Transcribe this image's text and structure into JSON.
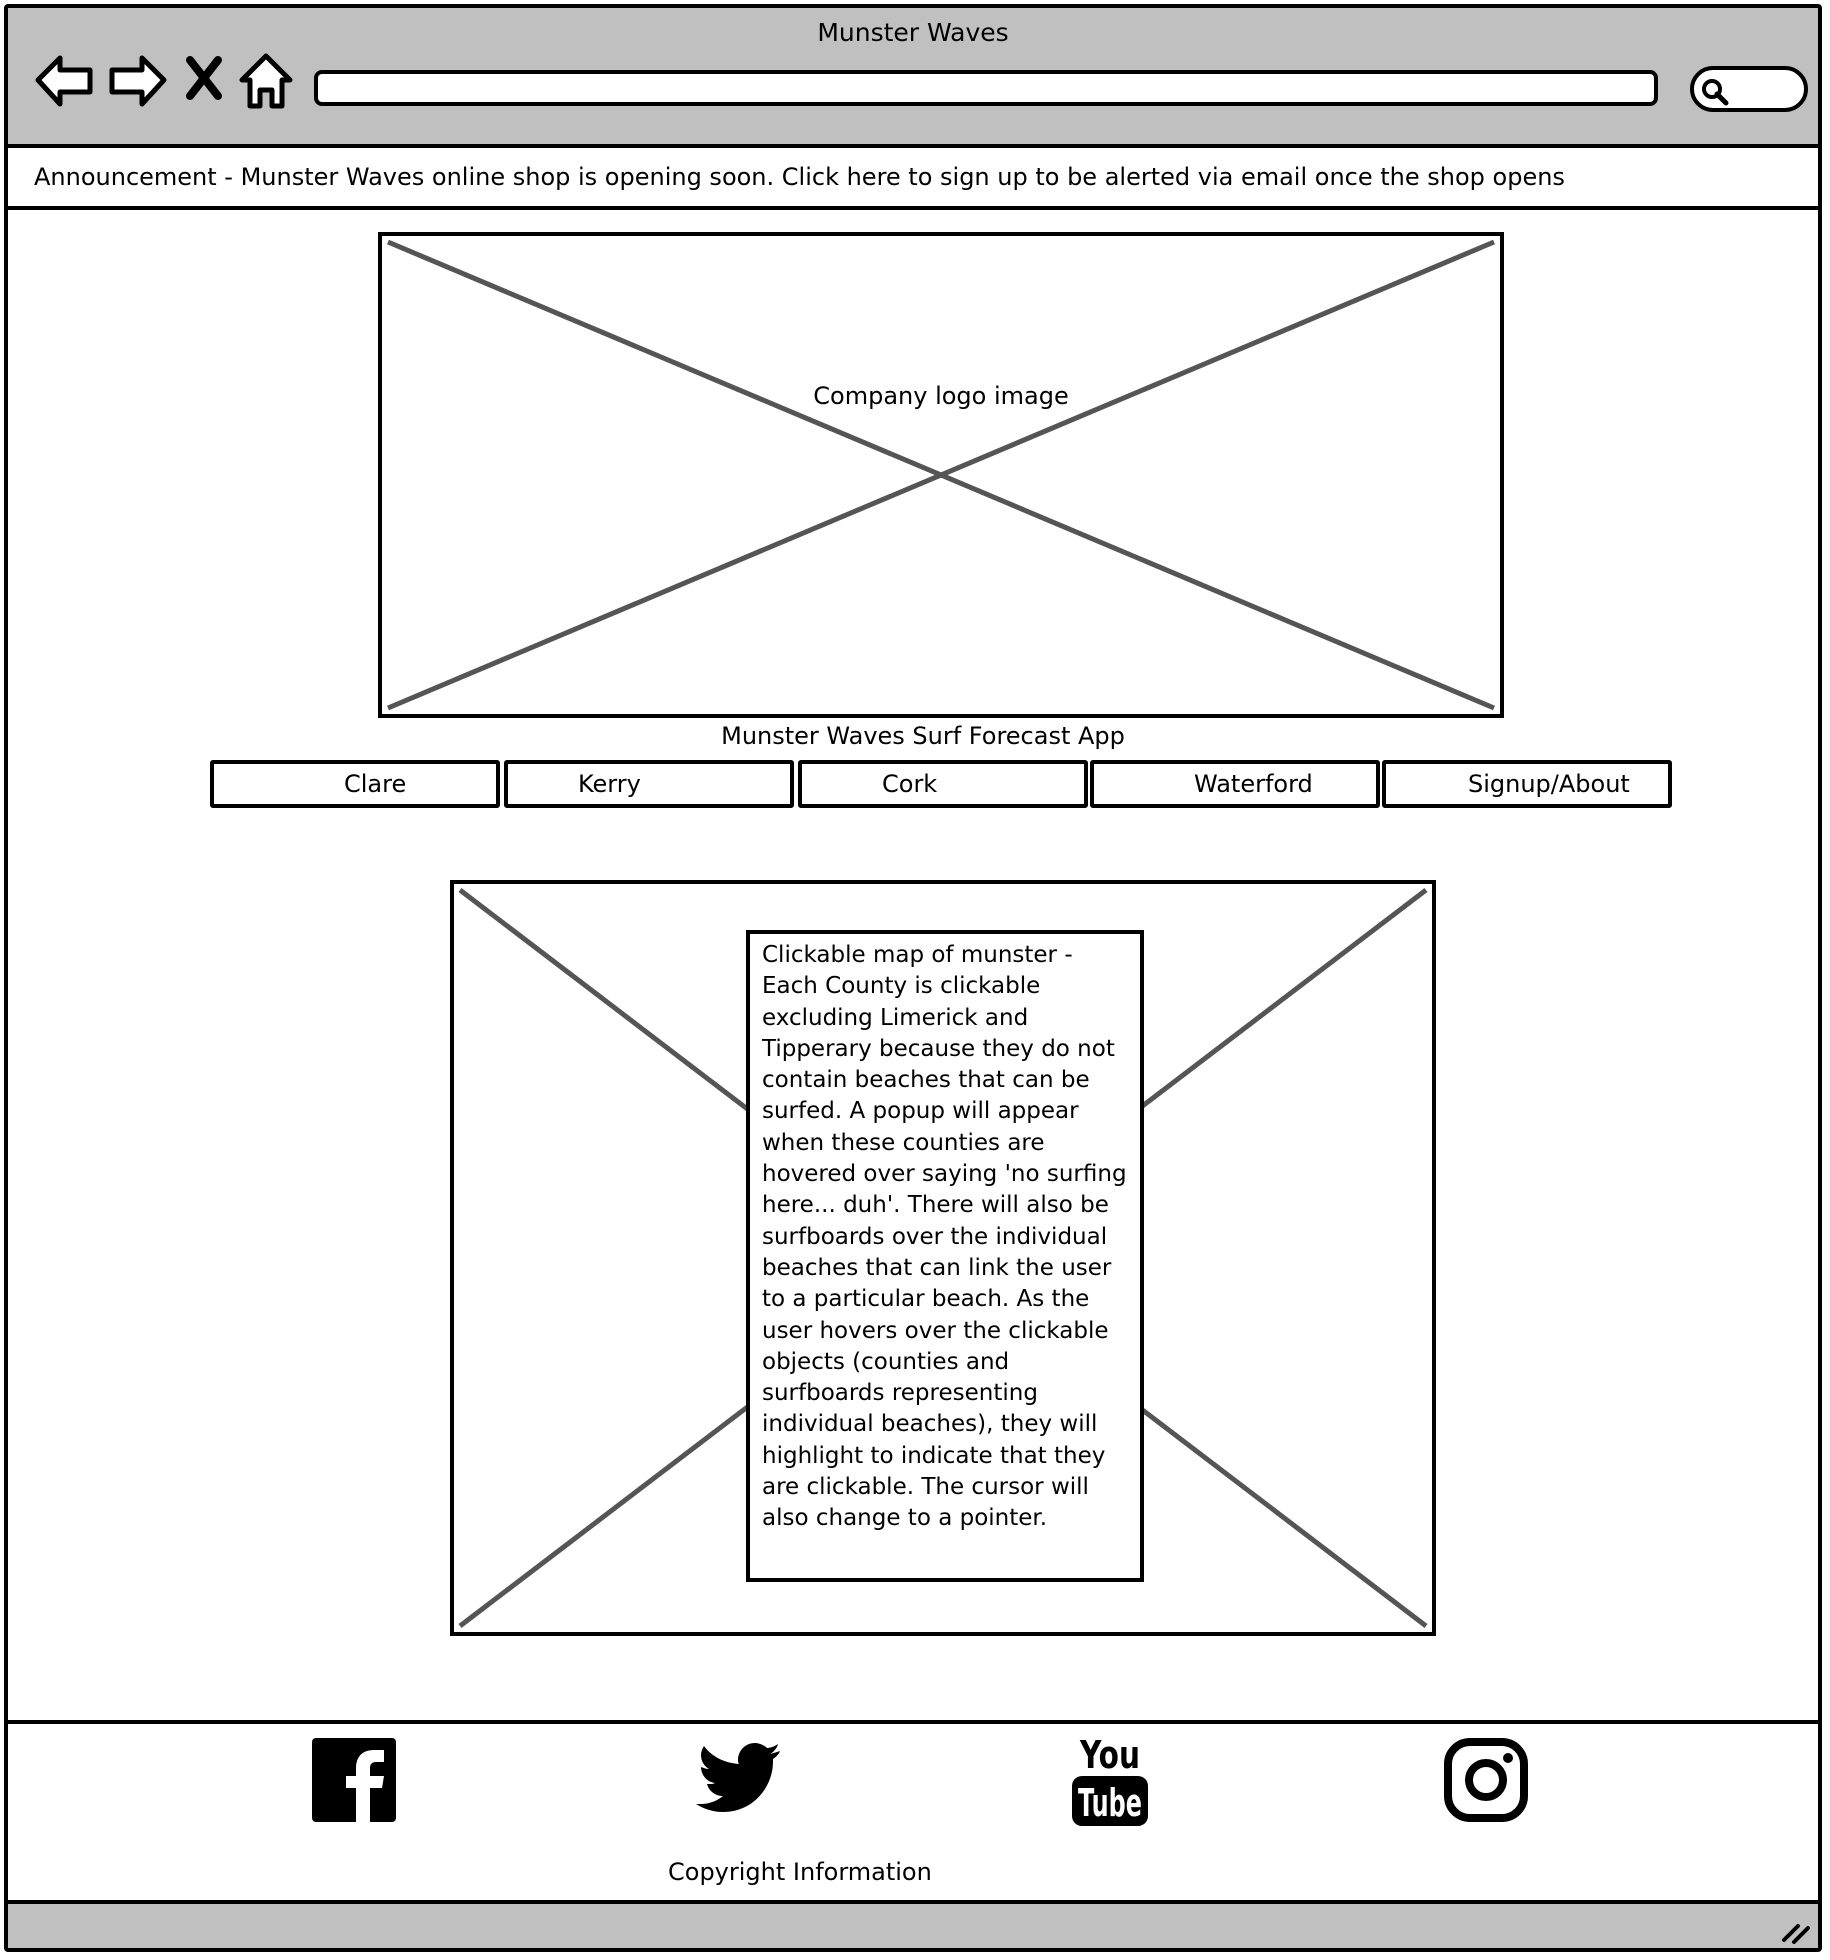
{
  "window": {
    "title": "Munster Waves"
  },
  "browser": {
    "address_value": "",
    "icons": [
      "back-arrow-icon",
      "forward-arrow-icon",
      "close-x-icon",
      "home-icon",
      "search-icon"
    ]
  },
  "announcement": {
    "text": "Announcement - Munster Waves online shop is opening soon. Click here to sign up to be alerted via email once the shop opens"
  },
  "logo": {
    "label": "Company logo image"
  },
  "app": {
    "title": "Munster Waves Surf Forecast App"
  },
  "nav": {
    "tabs": [
      {
        "label": "Clare"
      },
      {
        "label": "Kerry"
      },
      {
        "label": "Cork"
      },
      {
        "label": "Waterford"
      },
      {
        "label": "Signup/About"
      }
    ]
  },
  "map": {
    "description": "Clickable map of munster - Each County is clickable excluding Limerick and Tipperary because they do not contain beaches that can be surfed. A popup will appear when these counties are hovered over saying 'no surfing here... duh'. There will also be surfboards over the individual beaches that can link the user to a particular beach. As the user hovers over the clickable objects (counties and surfboards representing individual beaches), they will highlight to indicate that they are clickable. The cursor will also change to a pointer."
  },
  "footer": {
    "social_icons": [
      "facebook-icon",
      "twitter-icon",
      "youtube-icon",
      "instagram-icon"
    ],
    "youtube_text": {
      "top": "You",
      "bottom": "Tube"
    },
    "copyright": "Copyright Information"
  },
  "colors": {
    "chrome": "#c0c0c0",
    "placeholder_cross": "#555555",
    "ink": "#000000",
    "page": "#ffffff"
  }
}
